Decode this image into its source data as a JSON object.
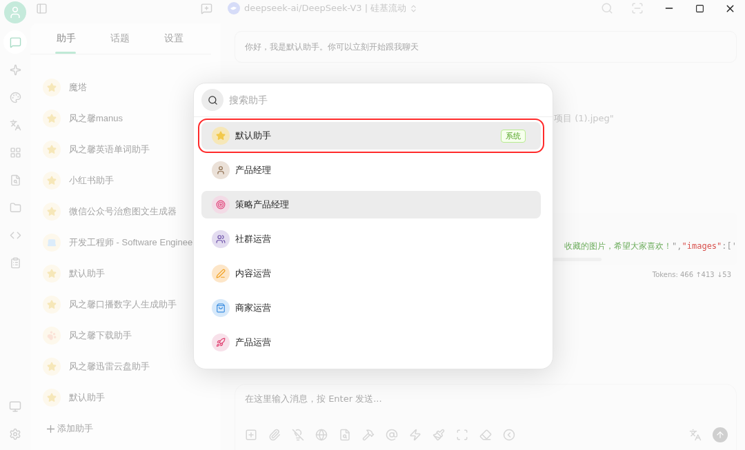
{
  "window": {
    "title": "deepseek-ai/DeepSeek-V3 | 硅基流动"
  },
  "nav_items": [
    {
      "kind": "chat",
      "selected": true
    },
    {
      "kind": "sparkle",
      "selected": false
    },
    {
      "kind": "palette",
      "selected": false
    },
    {
      "kind": "translate",
      "selected": false
    },
    {
      "kind": "grid",
      "selected": false
    },
    {
      "kind": "file",
      "selected": false
    },
    {
      "kind": "folder",
      "selected": false
    },
    {
      "kind": "code",
      "selected": false
    },
    {
      "kind": "notes",
      "selected": false
    }
  ],
  "sidebar": {
    "tabs": [
      {
        "label": "助手",
        "selected": true
      },
      {
        "label": "话题",
        "selected": false
      },
      {
        "label": "设置",
        "selected": false
      }
    ],
    "items": [
      {
        "name": "魔塔",
        "kind": "star"
      },
      {
        "name": "风之馨manus",
        "kind": "star"
      },
      {
        "name": "风之馨英语单词助手",
        "kind": "star"
      },
      {
        "name": "小红书助手",
        "kind": "star"
      },
      {
        "name": "微信公众号治愈图文生成器",
        "kind": "star"
      },
      {
        "name": "开发工程师 - Software Enginee",
        "kind": "computer"
      },
      {
        "name": "默认助手",
        "kind": "star"
      },
      {
        "name": "风之馨口播数字人生成助手",
        "kind": "star"
      },
      {
        "name": "风之馨下载助手",
        "kind": "paw"
      },
      {
        "name": "风之馨迅雷云盘助手",
        "kind": "star"
      },
      {
        "name": "默认助手",
        "kind": "star"
      }
    ],
    "add_button": "添加助手"
  },
  "chat": {
    "greeting": "你好，我是默认助手。你可以立刻开始跟我聊天",
    "message_fragment": "项目 (1).jpeg\"",
    "code_fragment": [
      {
        "text": "收藏的图片，希望大家喜欢！",
        "kind": "string"
      },
      {
        "text": "\",",
        "kind": "punct"
      },
      {
        "text": "\"images\"",
        "kind": "key"
      },
      {
        "text": ":['",
        "kind": "punct"
      }
    ],
    "tokens": "Tokens: 466 ↑413 ↓53",
    "input_placeholder": "在这里输入消息，按 Enter 发送..."
  },
  "assistant_picker": {
    "search_placeholder": "搜索助手",
    "items": [
      {
        "name": "默认助手",
        "kind": "star",
        "selected": true,
        "annotated": true,
        "badge": "系统"
      },
      {
        "name": "产品经理",
        "kind": "person",
        "selected": false,
        "annotated": false
      },
      {
        "name": "策略产品经理",
        "kind": "target",
        "selected": true,
        "annotated": false
      },
      {
        "name": "社群运营",
        "kind": "people",
        "selected": false,
        "annotated": false
      },
      {
        "name": "内容运营",
        "kind": "pen",
        "selected": false,
        "annotated": false
      },
      {
        "name": "商家运营",
        "kind": "bag",
        "selected": false,
        "annotated": false
      },
      {
        "name": "产品运营",
        "kind": "rocket",
        "selected": false,
        "annotated": false
      }
    ]
  }
}
